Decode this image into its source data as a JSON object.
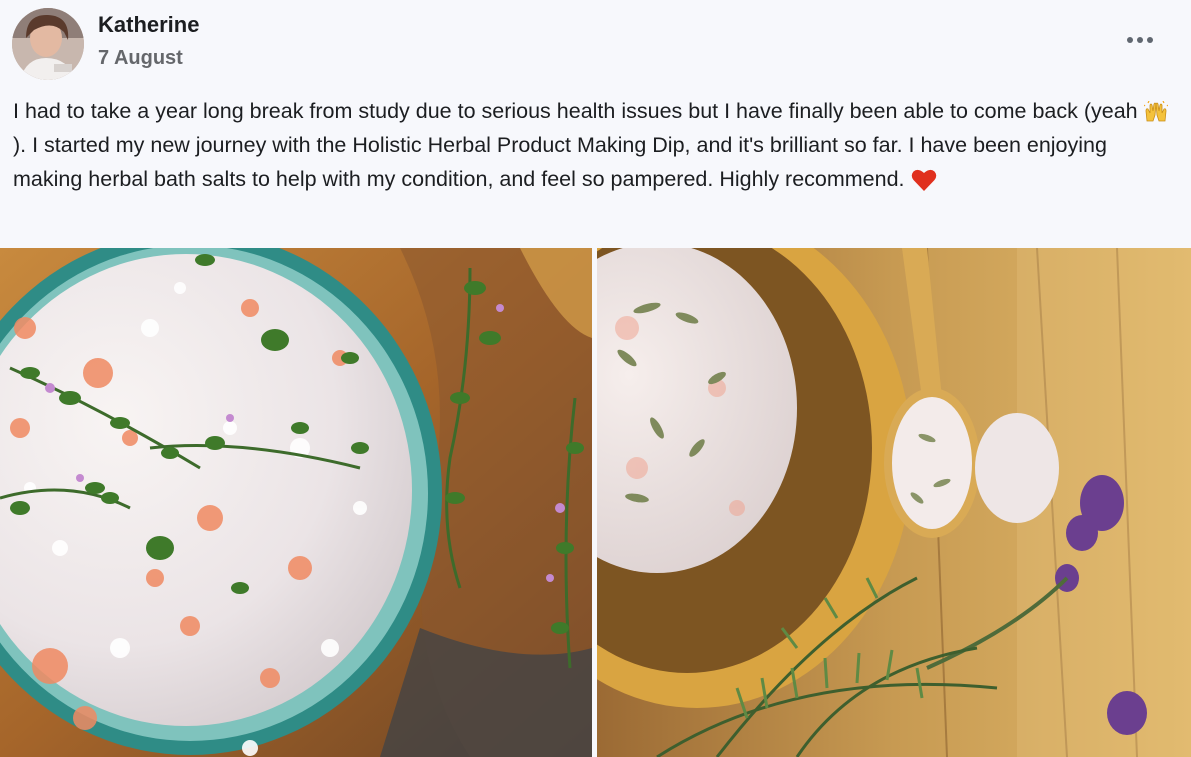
{
  "post": {
    "author": "Katherine",
    "date": "7 August",
    "text_part1": "I had to take a year long break from study due to serious health issues but I have finally been able to come back (yeah ",
    "text_part2": "). I started my new journey with the Holistic Herbal Product Making Dip, and it's brilliant so far. I have been enjoying making herbal bath salts to help with my condition, and feel so pampered. Highly recommend. "
  },
  "icons": {
    "more": "more-horizontal-icon",
    "raised_hands": "raised-hands-emoji-icon",
    "heart": "red-heart-emoji-icon"
  },
  "colors": {
    "heart": "#e0301e",
    "secondary_text": "#65676b",
    "background": "#f7f8fc"
  }
}
